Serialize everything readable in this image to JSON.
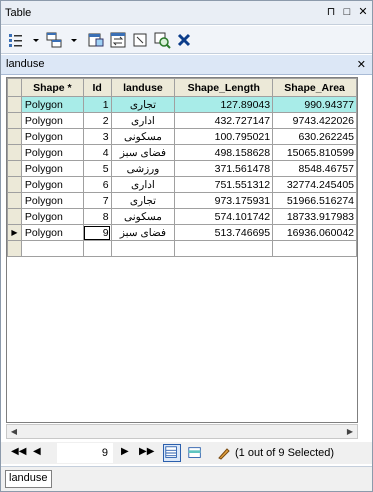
{
  "window": {
    "title": "Table",
    "pin_symbol": "⊓",
    "maximize_symbol": "□",
    "close_symbol": "✕"
  },
  "toolbar": {
    "icons": [
      "table-options-icon",
      "related-tables-icon",
      "select-by-attributes-icon",
      "switch-selection-icon",
      "clear-selection-icon",
      "zoom-to-selected-icon",
      "delete-selected-icon"
    ]
  },
  "table_tab": {
    "name": "landuse",
    "close_symbol": "✕"
  },
  "grid": {
    "columns": [
      "Shape *",
      "Id",
      "landuse",
      "Shape_Length",
      "Shape_Area"
    ],
    "rows": [
      {
        "shape": "Polygon",
        "id": "1",
        "landuse": "تجاری",
        "length": "127.89043",
        "area": "990.94377"
      },
      {
        "shape": "Polygon",
        "id": "2",
        "landuse": "اداری",
        "length": "432.727147",
        "area": "9743.422026"
      },
      {
        "shape": "Polygon",
        "id": "3",
        "landuse": "مسکونی",
        "length": "100.795021",
        "area": "630.262245"
      },
      {
        "shape": "Polygon",
        "id": "4",
        "landuse": "فضای سبز",
        "length": "498.158628",
        "area": "15065.810599"
      },
      {
        "shape": "Polygon",
        "id": "5",
        "landuse": "ورزشی",
        "length": "371.561478",
        "area": "8548.46757"
      },
      {
        "shape": "Polygon",
        "id": "6",
        "landuse": "اداری",
        "length": "751.551312",
        "area": "32774.245405"
      },
      {
        "shape": "Polygon",
        "id": "7",
        "landuse": "تجاری",
        "length": "973.175931",
        "area": "51966.516274"
      },
      {
        "shape": "Polygon",
        "id": "8",
        "landuse": "مسکونی",
        "length": "574.101742",
        "area": "18733.917983"
      },
      {
        "shape": "Polygon",
        "id": "9",
        "landuse": "فضای سبز",
        "length": "513.746695",
        "area": "16936.060042"
      }
    ],
    "current_row_marker": "▶"
  },
  "navigation": {
    "first": "◀◀",
    "prev": "◀",
    "current_record": "9",
    "next": "▶",
    "last": "▶▶",
    "selection_status": "(1 out of 9 Selected)"
  },
  "bottom_tab": {
    "label": "landuse"
  },
  "colors": {
    "highlight": "#a8ece8",
    "header": "#ece9d8",
    "title_bar": "#e9eef5"
  }
}
